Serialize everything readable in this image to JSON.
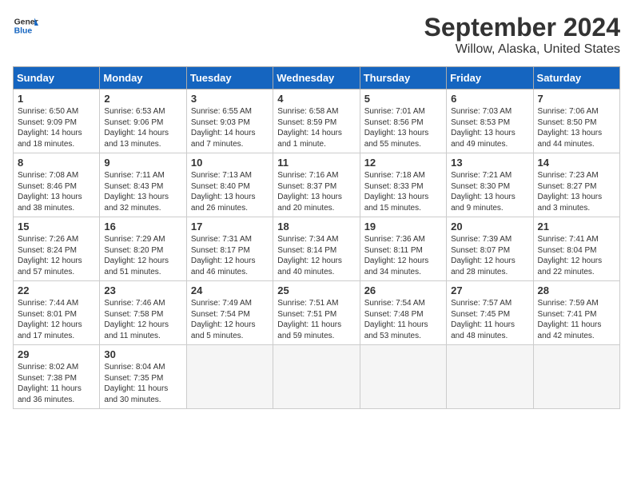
{
  "header": {
    "logo_general": "General",
    "logo_blue": "Blue",
    "title": "September 2024",
    "subtitle": "Willow, Alaska, United States"
  },
  "columns": [
    "Sunday",
    "Monday",
    "Tuesday",
    "Wednesday",
    "Thursday",
    "Friday",
    "Saturday"
  ],
  "weeks": [
    [
      {
        "day": "1",
        "info": "Sunrise: 6:50 AM\nSunset: 9:09 PM\nDaylight: 14 hours\nand 18 minutes."
      },
      {
        "day": "2",
        "info": "Sunrise: 6:53 AM\nSunset: 9:06 PM\nDaylight: 14 hours\nand 13 minutes."
      },
      {
        "day": "3",
        "info": "Sunrise: 6:55 AM\nSunset: 9:03 PM\nDaylight: 14 hours\nand 7 minutes."
      },
      {
        "day": "4",
        "info": "Sunrise: 6:58 AM\nSunset: 8:59 PM\nDaylight: 14 hours\nand 1 minute."
      },
      {
        "day": "5",
        "info": "Sunrise: 7:01 AM\nSunset: 8:56 PM\nDaylight: 13 hours\nand 55 minutes."
      },
      {
        "day": "6",
        "info": "Sunrise: 7:03 AM\nSunset: 8:53 PM\nDaylight: 13 hours\nand 49 minutes."
      },
      {
        "day": "7",
        "info": "Sunrise: 7:06 AM\nSunset: 8:50 PM\nDaylight: 13 hours\nand 44 minutes."
      }
    ],
    [
      {
        "day": "8",
        "info": "Sunrise: 7:08 AM\nSunset: 8:46 PM\nDaylight: 13 hours\nand 38 minutes."
      },
      {
        "day": "9",
        "info": "Sunrise: 7:11 AM\nSunset: 8:43 PM\nDaylight: 13 hours\nand 32 minutes."
      },
      {
        "day": "10",
        "info": "Sunrise: 7:13 AM\nSunset: 8:40 PM\nDaylight: 13 hours\nand 26 minutes."
      },
      {
        "day": "11",
        "info": "Sunrise: 7:16 AM\nSunset: 8:37 PM\nDaylight: 13 hours\nand 20 minutes."
      },
      {
        "day": "12",
        "info": "Sunrise: 7:18 AM\nSunset: 8:33 PM\nDaylight: 13 hours\nand 15 minutes."
      },
      {
        "day": "13",
        "info": "Sunrise: 7:21 AM\nSunset: 8:30 PM\nDaylight: 13 hours\nand 9 minutes."
      },
      {
        "day": "14",
        "info": "Sunrise: 7:23 AM\nSunset: 8:27 PM\nDaylight: 13 hours\nand 3 minutes."
      }
    ],
    [
      {
        "day": "15",
        "info": "Sunrise: 7:26 AM\nSunset: 8:24 PM\nDaylight: 12 hours\nand 57 minutes."
      },
      {
        "day": "16",
        "info": "Sunrise: 7:29 AM\nSunset: 8:20 PM\nDaylight: 12 hours\nand 51 minutes."
      },
      {
        "day": "17",
        "info": "Sunrise: 7:31 AM\nSunset: 8:17 PM\nDaylight: 12 hours\nand 46 minutes."
      },
      {
        "day": "18",
        "info": "Sunrise: 7:34 AM\nSunset: 8:14 PM\nDaylight: 12 hours\nand 40 minutes."
      },
      {
        "day": "19",
        "info": "Sunrise: 7:36 AM\nSunset: 8:11 PM\nDaylight: 12 hours\nand 34 minutes."
      },
      {
        "day": "20",
        "info": "Sunrise: 7:39 AM\nSunset: 8:07 PM\nDaylight: 12 hours\nand 28 minutes."
      },
      {
        "day": "21",
        "info": "Sunrise: 7:41 AM\nSunset: 8:04 PM\nDaylight: 12 hours\nand 22 minutes."
      }
    ],
    [
      {
        "day": "22",
        "info": "Sunrise: 7:44 AM\nSunset: 8:01 PM\nDaylight: 12 hours\nand 17 minutes."
      },
      {
        "day": "23",
        "info": "Sunrise: 7:46 AM\nSunset: 7:58 PM\nDaylight: 12 hours\nand 11 minutes."
      },
      {
        "day": "24",
        "info": "Sunrise: 7:49 AM\nSunset: 7:54 PM\nDaylight: 12 hours\nand 5 minutes."
      },
      {
        "day": "25",
        "info": "Sunrise: 7:51 AM\nSunset: 7:51 PM\nDaylight: 11 hours\nand 59 minutes."
      },
      {
        "day": "26",
        "info": "Sunrise: 7:54 AM\nSunset: 7:48 PM\nDaylight: 11 hours\nand 53 minutes."
      },
      {
        "day": "27",
        "info": "Sunrise: 7:57 AM\nSunset: 7:45 PM\nDaylight: 11 hours\nand 48 minutes."
      },
      {
        "day": "28",
        "info": "Sunrise: 7:59 AM\nSunset: 7:41 PM\nDaylight: 11 hours\nand 42 minutes."
      }
    ],
    [
      {
        "day": "29",
        "info": "Sunrise: 8:02 AM\nSunset: 7:38 PM\nDaylight: 11 hours\nand 36 minutes."
      },
      {
        "day": "30",
        "info": "Sunrise: 8:04 AM\nSunset: 7:35 PM\nDaylight: 11 hours\nand 30 minutes."
      },
      {
        "day": "",
        "info": ""
      },
      {
        "day": "",
        "info": ""
      },
      {
        "day": "",
        "info": ""
      },
      {
        "day": "",
        "info": ""
      },
      {
        "day": "",
        "info": ""
      }
    ]
  ]
}
